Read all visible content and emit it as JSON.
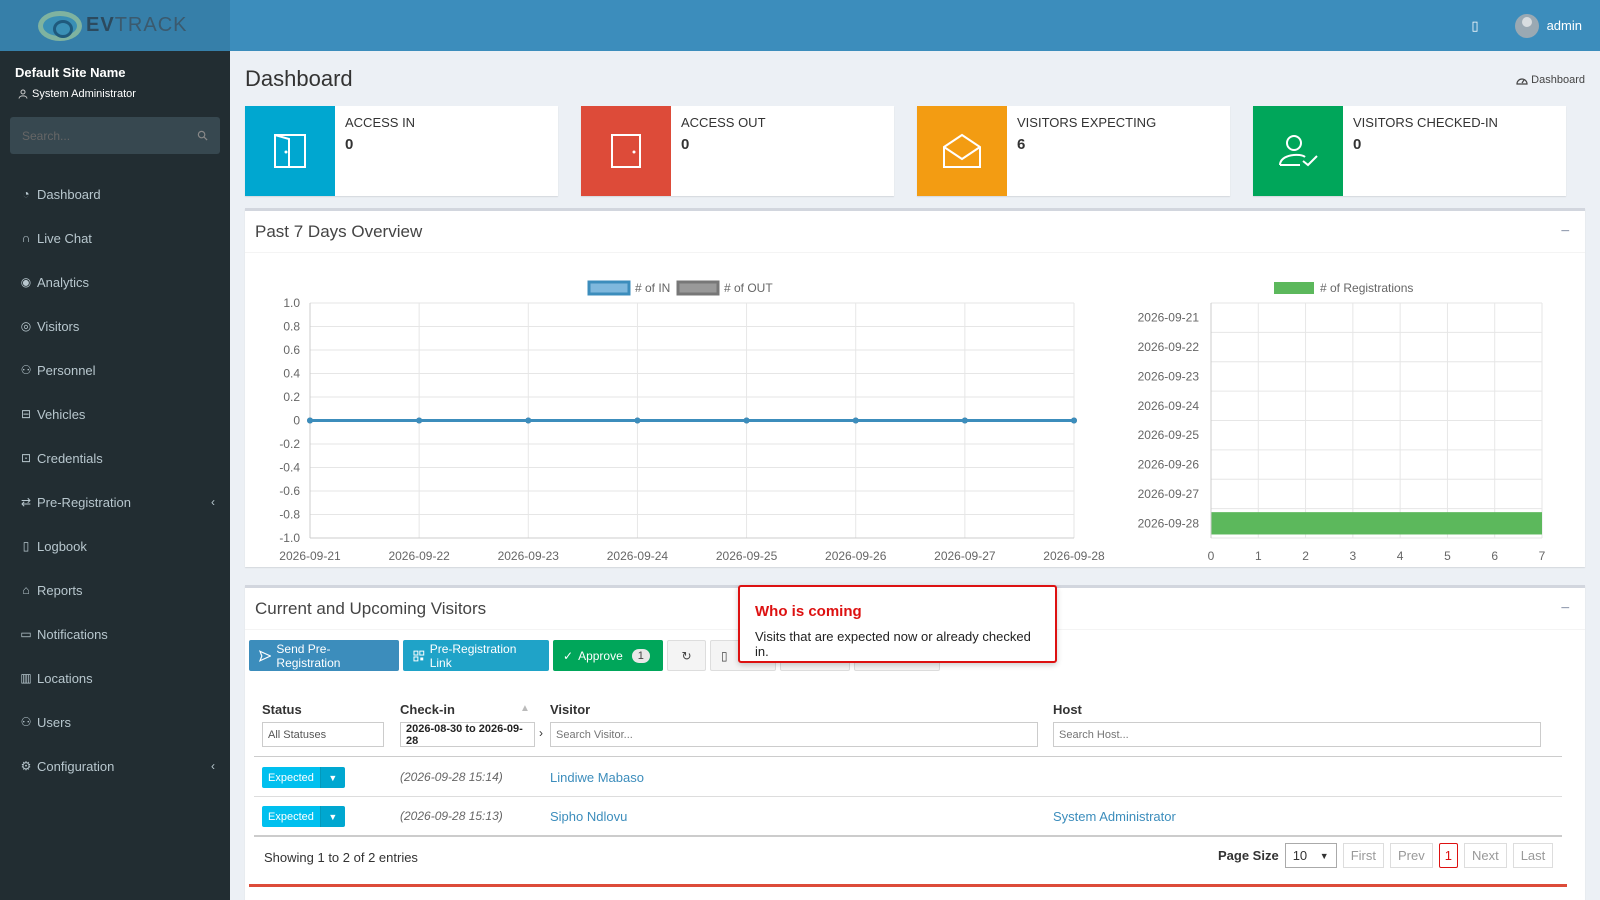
{
  "brand": {
    "logo_bold": "EV",
    "logo_rest": "TRACK"
  },
  "sidebar": {
    "site_name": "Default Site Name",
    "role": "System Administrator",
    "search_placeholder": "Search...",
    "items": [
      {
        "label": "Dashboard",
        "icon": "dashboard-icon"
      },
      {
        "label": "Live Chat",
        "icon": "headset-icon"
      },
      {
        "label": "Analytics",
        "icon": "target-icon"
      },
      {
        "label": "Visitors",
        "icon": "eye-icon"
      },
      {
        "label": "Personnel",
        "icon": "people-icon"
      },
      {
        "label": "Vehicles",
        "icon": "car-icon"
      },
      {
        "label": "Credentials",
        "icon": "id-card-icon"
      },
      {
        "label": "Pre-Registration",
        "icon": "exchange-icon",
        "chevron": true
      },
      {
        "label": "Logbook",
        "icon": "book-icon"
      },
      {
        "label": "Reports",
        "icon": "chart-icon"
      },
      {
        "label": "Notifications",
        "icon": "chat-icon"
      },
      {
        "label": "Locations",
        "icon": "map-icon"
      },
      {
        "label": "Users",
        "icon": "users-icon"
      },
      {
        "label": "Configuration",
        "icon": "gear-icon",
        "chevron": true
      }
    ]
  },
  "header": {
    "user": "admin"
  },
  "page": {
    "title": "Dashboard",
    "breadcrumb": "Dashboard"
  },
  "info_boxes": [
    {
      "label": "ACCESS IN",
      "value": "0",
      "color": "#00a7d0"
    },
    {
      "label": "ACCESS OUT",
      "value": "0",
      "color": "#dd4b39"
    },
    {
      "label": "VISITORS EXPECTING",
      "value": "6",
      "color": "#f39c12"
    },
    {
      "label": "VISITORS CHECKED-IN",
      "value": "0",
      "color": "#00a65a"
    }
  ],
  "overview": {
    "title": "Past 7 Days Overview",
    "collapse": "−"
  },
  "chart_data": [
    {
      "type": "line",
      "x": [
        "2026-09-21",
        "2026-09-22",
        "2026-09-23",
        "2026-09-24",
        "2026-09-25",
        "2026-09-26",
        "2026-09-27",
        "2026-09-28"
      ],
      "series": [
        {
          "name": "# of IN",
          "values": [
            0,
            0,
            0,
            0,
            0,
            0,
            0,
            0
          ],
          "color": "#3c8dbc"
        },
        {
          "name": "# of OUT",
          "values": [
            0,
            0,
            0,
            0,
            0,
            0,
            0,
            0
          ],
          "color": "#777777"
        }
      ],
      "y_ticks": [
        "1.0",
        "0.8",
        "0.6",
        "0.4",
        "0.2",
        "0",
        "-0.2",
        "-0.4",
        "-0.6",
        "-0.8",
        "-1.0"
      ],
      "ylim": [
        -1,
        1
      ],
      "grid": true,
      "legend": "top-center"
    },
    {
      "type": "bar",
      "orientation": "horizontal",
      "categories": [
        "2026-09-21",
        "2026-09-22",
        "2026-09-23",
        "2026-09-24",
        "2026-09-25",
        "2026-09-26",
        "2026-09-27",
        "2026-09-28"
      ],
      "series": [
        {
          "name": "# of Registrations",
          "values": [
            0,
            0,
            0,
            0,
            0,
            0,
            0,
            7
          ],
          "color": "#5cb85c"
        }
      ],
      "x_ticks": [
        "0",
        "1",
        "2",
        "3",
        "4",
        "5",
        "6",
        "7"
      ],
      "xlim": [
        0,
        7
      ],
      "grid": true,
      "legend": "top-center"
    }
  ],
  "visitors": {
    "title": "Current and Upcoming Visitors",
    "collapse": "−",
    "buttons": {
      "send_prereg": "Send Pre-Registration",
      "prereg_link": "Pre-Registration Link",
      "approve": "Approve",
      "approve_count": "1"
    },
    "columns": {
      "status": "Status",
      "checkin": "Check-in",
      "visitor": "Visitor",
      "host": "Host"
    },
    "filters": {
      "status": "All Statuses",
      "date_range": "2026-08-30 to 2026-09-28",
      "visitor_placeholder": "Search Visitor...",
      "host_placeholder": "Search Host..."
    },
    "rows": [
      {
        "status": "Expected",
        "time": "(2026-09-28 15:14)",
        "visitor": "Lindiwe Mabaso",
        "host": ""
      },
      {
        "status": "Expected",
        "time": "(2026-09-28 15:13)",
        "visitor": "Sipho Ndlovu",
        "host": "System Administrator"
      }
    ],
    "summary": "Showing 1 to 2 of 2 entries",
    "page_size_label": "Page Size",
    "page_size": "10",
    "pager": {
      "first": "First",
      "prev": "Prev",
      "current": "1",
      "next": "Next",
      "last": "Last"
    }
  },
  "tooltip": {
    "title": "Who is coming",
    "text": "Visits that are expected now or already checked in."
  }
}
